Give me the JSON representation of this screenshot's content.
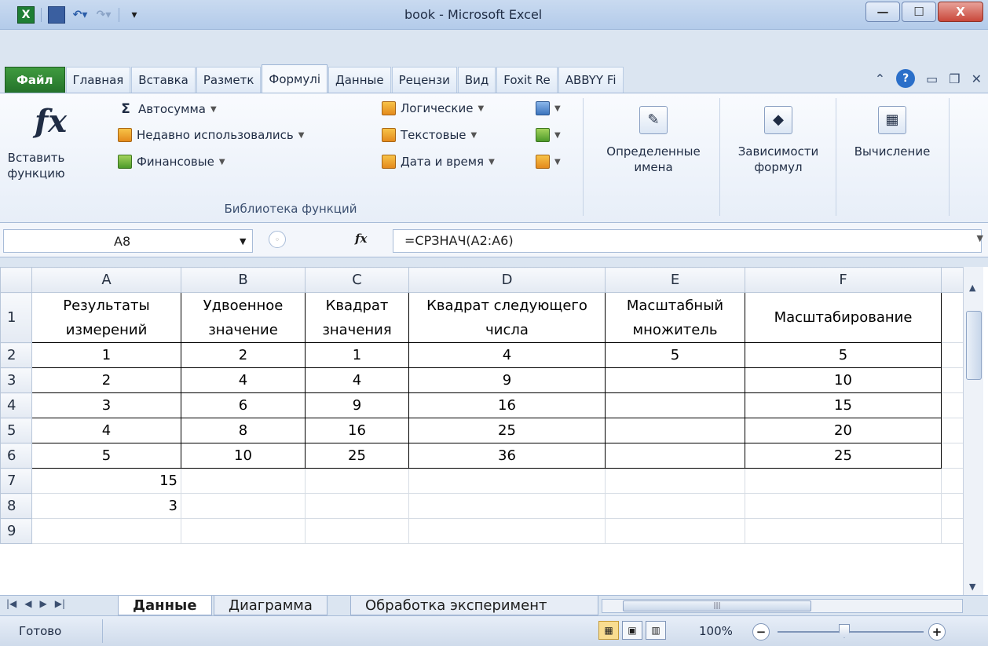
{
  "window": {
    "title": "book - Microsoft Excel",
    "controls": [
      "—",
      "☐",
      "X"
    ]
  },
  "tabs": [
    "Файл",
    "Главная",
    "Вставка",
    "Разметк",
    "Формулі",
    "Данные",
    "Рецензи",
    "Вид",
    "Foxit Re",
    "ABBYY Fi"
  ],
  "active_tab": "Формулі",
  "ribbon": {
    "insert_function": "Вставить функцию",
    "autosum": "Автосумма",
    "recent": "Недавно использовались",
    "financial": "Финансовые",
    "logical": "Логические",
    "text": "Текстовые",
    "datetime": "Дата и время",
    "group_title": "Библиотека функций",
    "defined_names": "Определенные имена",
    "formula_auditing": "Зависимости формул",
    "calculation": "Вычисление"
  },
  "formula_bar": {
    "name_box": "A8",
    "fx": "fx",
    "formula": "=СРЗНАЧ(A2:A6)"
  },
  "grid": {
    "columns": [
      "A",
      "B",
      "C",
      "D",
      "E",
      "F"
    ],
    "header_row": {
      "row": "1",
      "cells": [
        "Результаты измерений",
        "Удвоенное значение",
        "Квадрат значения",
        "Квадрат следующего числа",
        "Масштабный множитель",
        "Масштабирование"
      ]
    },
    "rows": [
      {
        "row": "2",
        "cells": [
          "1",
          "2",
          "1",
          "4",
          "5",
          "5"
        ]
      },
      {
        "row": "3",
        "cells": [
          "2",
          "4",
          "4",
          "9",
          "",
          "10"
        ]
      },
      {
        "row": "4",
        "cells": [
          "3",
          "6",
          "9",
          "16",
          "",
          "15"
        ]
      },
      {
        "row": "5",
        "cells": [
          "4",
          "8",
          "16",
          "25",
          "",
          "20"
        ]
      },
      {
        "row": "6",
        "cells": [
          "5",
          "10",
          "25",
          "36",
          "",
          "25"
        ]
      },
      {
        "row": "7",
        "cells": [
          "15",
          "",
          "",
          "",
          "",
          ""
        ]
      },
      {
        "row": "8",
        "cells": [
          "3",
          "",
          "",
          "",
          "",
          ""
        ]
      },
      {
        "row": "9",
        "cells": [
          "",
          "",
          "",
          "",
          "",
          ""
        ]
      }
    ]
  },
  "sheets": [
    "Данные",
    "Диаграмма",
    "Обработка эксперимент"
  ],
  "active_sheet": "Данные",
  "status": {
    "ready": "Готово",
    "zoom": "100%"
  }
}
